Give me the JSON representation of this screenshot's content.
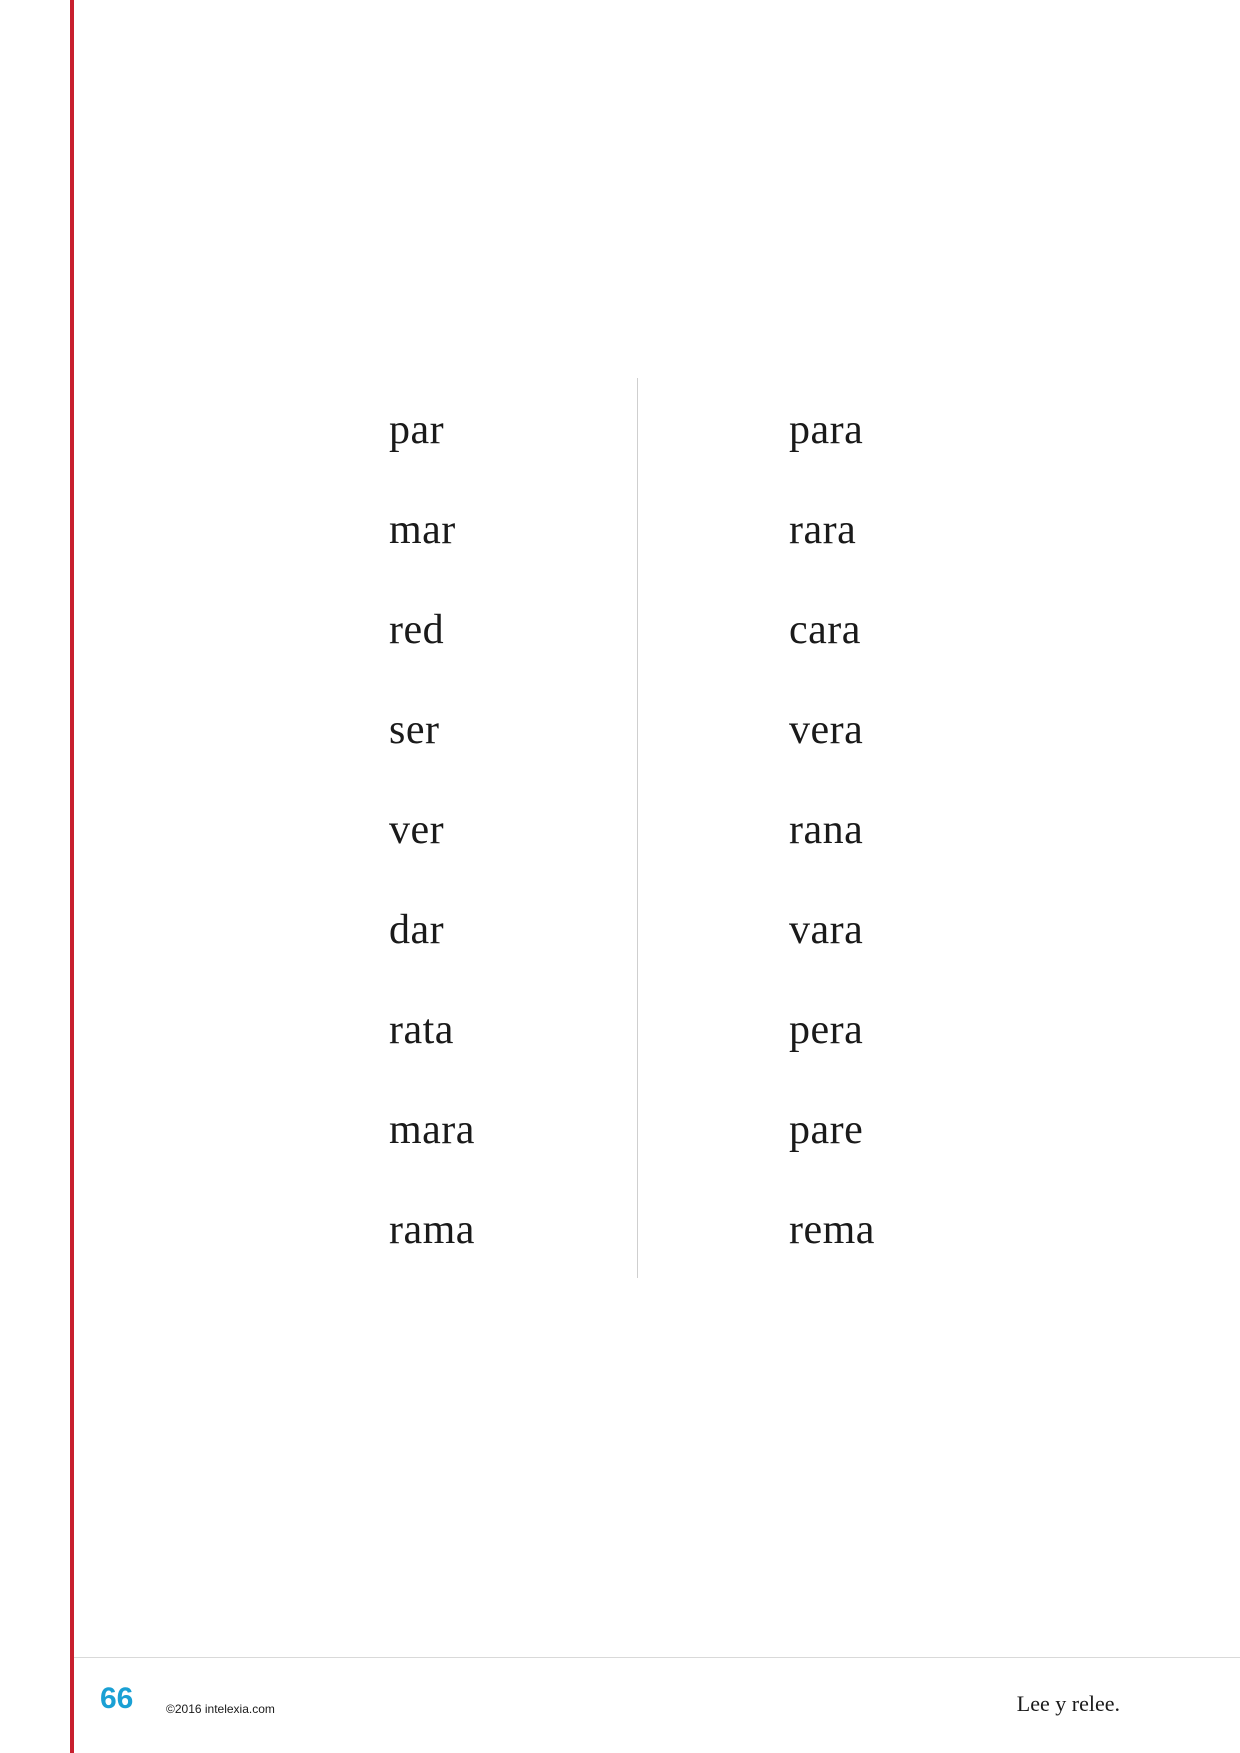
{
  "colors": {
    "margin_rule": "#c8202e",
    "page_number": "#1aa0d4",
    "text": "#1a1a1a",
    "divider": "#cfcfcf"
  },
  "words": {
    "left": [
      "par",
      "mar",
      "red",
      "ser",
      "ver",
      "dar",
      "rata",
      "mara",
      "rama"
    ],
    "right": [
      "para",
      "rara",
      "cara",
      "vera",
      "rana",
      "vara",
      "pera",
      "pare",
      "rema"
    ]
  },
  "footer": {
    "page_number": "66",
    "copyright": "©2016 intelexia.com",
    "instruction": "Lee y relee."
  }
}
